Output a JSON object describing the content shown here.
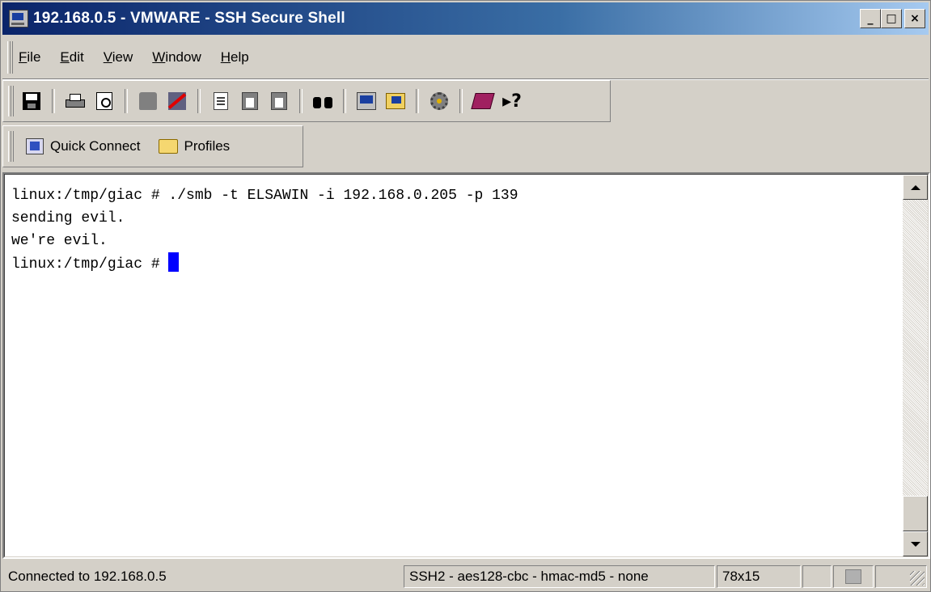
{
  "window": {
    "title": "192.168.0.5 - VMWARE - SSH Secure Shell",
    "caption_buttons": [
      "_",
      "□",
      "×"
    ]
  },
  "menu": {
    "items": [
      {
        "label": "File",
        "accel": "F",
        "rest": "ile"
      },
      {
        "label": "Edit",
        "accel": "E",
        "rest": "dit"
      },
      {
        "label": "View",
        "accel": "V",
        "rest": "iew"
      },
      {
        "label": "Window",
        "accel": "W",
        "rest": "indow"
      },
      {
        "label": "Help",
        "accel": "H",
        "rest": "elp"
      }
    ]
  },
  "toolbar": {
    "icons": [
      "save-icon",
      "print-icon",
      "print-preview-icon",
      "keys-icon",
      "disconnect-icon",
      "copy-icon",
      "paste-icon",
      "paste-special-icon",
      "find-icon",
      "new-terminal-icon",
      "new-file-transfer-icon",
      "settings-icon",
      "help-book-icon",
      "whats-this-icon"
    ],
    "help_glyph": "▸?"
  },
  "quickbar": {
    "quick_connect": "Quick Connect",
    "profiles": "Profiles"
  },
  "terminal": {
    "lines": [
      "linux:/tmp/giac # ./smb -t ELSAWIN -i 192.168.0.205 -p 139",
      "sending evil.",
      "we're evil.",
      "linux:/tmp/giac # "
    ],
    "cursor_color": "#0000ff"
  },
  "status": {
    "connection": "Connected to 192.168.0.5",
    "cipher": "SSH2 - aes128-cbc - hmac-md5 - none",
    "size": "78x15"
  }
}
